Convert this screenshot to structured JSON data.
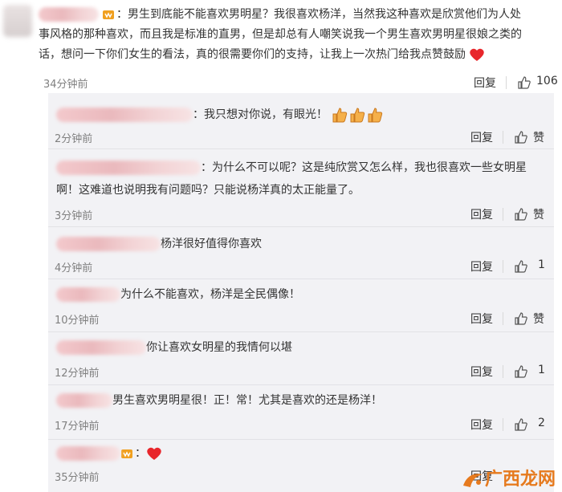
{
  "main": {
    "text_line1": "男生到底能不能喜欢男明星？我很喜欢杨洋，当然我这种喜欢是欣赏他们为人处",
    "text_line2": "事风格的那种喜欢，而且我是标准的直男，但是却总有人嘲笑说我一个男生喜欢男明星很娘之类的",
    "text_line3": "话，想问一下你们女生的看法，真的很需要你们的支持，让我上一次热门给我点赞鼓励",
    "time": "34分钟前",
    "reply_label": "回复",
    "like_count": "106"
  },
  "replies": [
    {
      "text": "我只想对你说，有眼光！",
      "time": "2分钟前",
      "reply_label": "回复",
      "like_label": "赞"
    },
    {
      "text": "为什么不可以呢？这是纯欣赏又怎么样，我也很喜欢一些女明星",
      "text2": "啊！这难道也说明我有问题吗？只能说杨洋真的太正能量了。",
      "time": "3分钟前",
      "reply_label": "回复",
      "like_label": "赞"
    },
    {
      "text": "杨洋很好值得你喜欢",
      "time": "4分钟前",
      "reply_label": "回复",
      "like_label": "1"
    },
    {
      "text": "为什么不能喜欢，杨洋是全民偶像！",
      "time": "10分钟前",
      "reply_label": "回复",
      "like_label": "赞"
    },
    {
      "text": "你让喜欢女明星的我情何以堪",
      "time": "12分钟前",
      "reply_label": "回复",
      "like_label": "1"
    },
    {
      "text": "男生喜欢男明星很！正！常！尤其是喜欢的还是杨洋！",
      "time": "17分钟前",
      "reply_label": "回复",
      "like_label": "2"
    },
    {
      "text": "",
      "time": "35分钟前",
      "reply_label": "回复",
      "like_label": ""
    }
  ],
  "watermark": {
    "text": "广西龙网"
  },
  "colors": {
    "accent": "#e67a1e",
    "reply_bg": "#f2f2f5",
    "heart": "#e8262b"
  }
}
